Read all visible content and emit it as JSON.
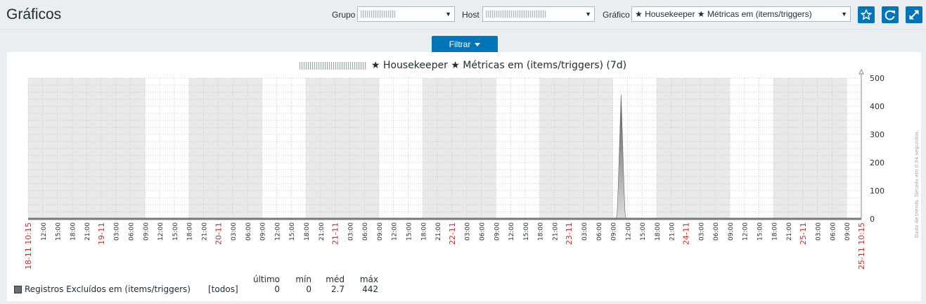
{
  "page": {
    "title": "Gráficos"
  },
  "controls": {
    "group_label": "Grupo",
    "host_label": "Host",
    "graph_label": "Gráfico",
    "graph_value": "★ Housekeeper ★ Métricas em (items/triggers)"
  },
  "icons": {
    "favorite": "star-icon",
    "refresh": "refresh-icon",
    "fullscreen": "fullscreen-icon"
  },
  "filter": {
    "label": "Filtrar"
  },
  "colors": {
    "accent": "#0275b8",
    "series": "#6c6c6c",
    "date_label": "#c92a2a"
  },
  "graph": {
    "title": "★ Housekeeper ★ Métricas em (items/triggers)  (7d)",
    "side_note": "Dado de trends. Gerado em 0.04 segundos."
  },
  "legend": {
    "headers": {
      "last": "último",
      "min": "mín",
      "avg": "méd",
      "max": "máx"
    },
    "items": [
      {
        "name": "Registros Excluídos em (items/triggers)",
        "func": "[todos]",
        "last": "0",
        "min": "0",
        "avg": "2.7",
        "max": "442"
      }
    ]
  },
  "chart_data": {
    "type": "area",
    "title": "★ Housekeeper ★ Métricas em (items/triggers)  (7d)",
    "y_ticks": [
      "0",
      "100",
      "200",
      "300",
      "400",
      "500"
    ],
    "ylim": [
      0,
      500
    ],
    "x_tick_labels": [
      "18-11 10:15",
      "12:00",
      "15:00",
      "18:00",
      "21:00",
      "19-11",
      "03:00",
      "06:00",
      "09:00",
      "12:00",
      "15:00",
      "18:00",
      "21:00",
      "20-11",
      "03:00",
      "06:00",
      "09:00",
      "12:00",
      "15:00",
      "18:00",
      "21:00",
      "21-11",
      "03:00",
      "06:00",
      "09:00",
      "12:00",
      "15:00",
      "18:00",
      "21:00",
      "22-11",
      "03:00",
      "06:00",
      "09:00",
      "12:00",
      "15:00",
      "18:00",
      "21:00",
      "23-11",
      "03:00",
      "06:00",
      "09:00",
      "12:00",
      "15:00",
      "18:00",
      "21:00",
      "24-11",
      "03:00",
      "06:00",
      "09:00",
      "12:00",
      "15:00",
      "18:00",
      "21:00",
      "25-11",
      "03:00",
      "06:00",
      "09:00",
      "25-11 10:15"
    ],
    "series": [
      {
        "name": "Registros Excluídos em (items/triggers)",
        "peak_time": "23-11 11:00",
        "values": [
          0,
          20,
          110,
          220,
          330,
          442,
          330,
          220,
          110,
          20,
          0
        ]
      }
    ],
    "grid": true
  }
}
